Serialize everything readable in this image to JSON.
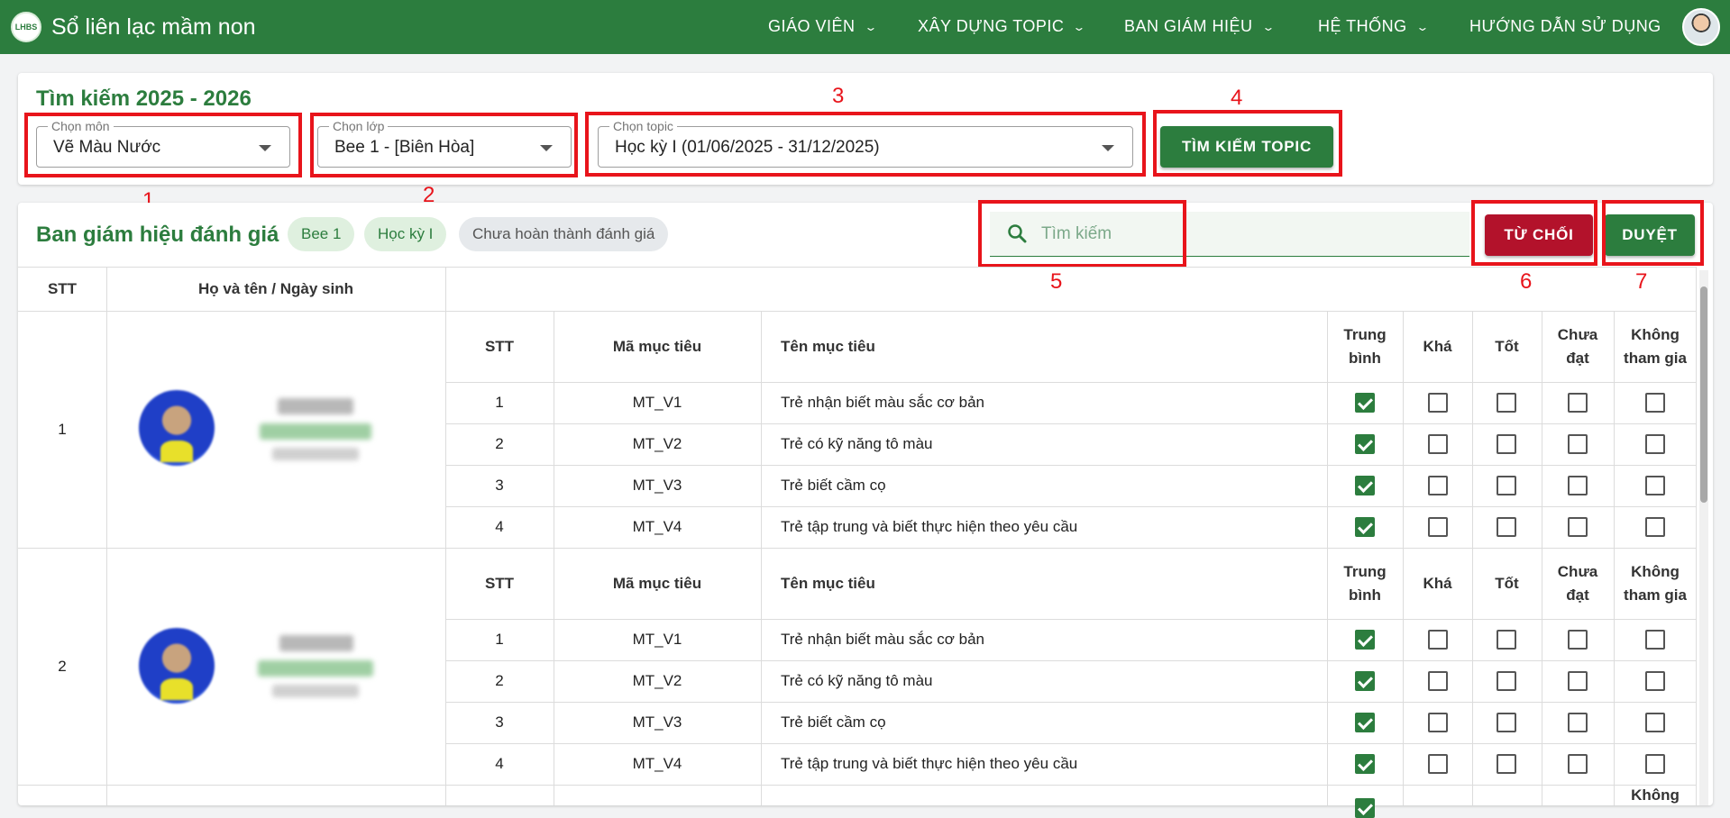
{
  "header": {
    "logo_text": "LHBS",
    "title": "Sổ liên lạc mầm non",
    "nav": [
      "GIÁO VIÊN",
      "XÂY DỰNG TOPIC",
      "BAN GIÁM HIỆU",
      "HỆ THỐNG",
      "HƯỚNG DẪN SỬ DỤNG"
    ],
    "chevron": "⌄"
  },
  "search_card": {
    "title": "Tìm kiếm 2025 - 2026",
    "subject": {
      "label": "Chọn môn",
      "value": "Vẽ Màu Nước"
    },
    "class": {
      "label": "Chọn lớp",
      "value": "Bee 1 - [Biên Hòa]"
    },
    "topic": {
      "label": "Chọn topic",
      "value": "Học kỳ I (01/06/2025 - 31/12/2025)"
    },
    "search_button": "TÌM KIẾM TOPIC"
  },
  "annotations": [
    "1",
    "2",
    "3",
    "4",
    "5",
    "6",
    "7"
  ],
  "eval_card": {
    "title": "Ban giám hiệu đánh giá",
    "chips": [
      "Bee 1",
      "Học kỳ I",
      "Chưa hoàn thành đánh giá"
    ],
    "search_placeholder": "Tìm kiếm",
    "reject_button": "TỪ CHỐI",
    "approve_button": "DUYỆT"
  },
  "table": {
    "outer_headers": {
      "stt": "STT",
      "name": "Họ và tên / Ngày sinh"
    },
    "inner_headers": {
      "stt": "STT",
      "code": "Mã mục tiêu",
      "name": "Tên mục tiêu",
      "levels": [
        "Trung bình",
        "Khá",
        "Tốt",
        "Chưa đạt",
        "Không tham gia"
      ]
    },
    "students": [
      {
        "stt": "1",
        "goals": [
          {
            "stt": "1",
            "code": "MT_V1",
            "name": "Trẻ nhận biết màu sắc cơ bản",
            "checked": 0
          },
          {
            "stt": "2",
            "code": "MT_V2",
            "name": "Trẻ có kỹ năng tô màu",
            "checked": 0
          },
          {
            "stt": "3",
            "code": "MT_V3",
            "name": "Trẻ biết cầm cọ",
            "checked": 0
          },
          {
            "stt": "4",
            "code": "MT_V4",
            "name": "Trẻ tập trung và biết thực hiện theo yêu cầu",
            "checked": 0
          }
        ]
      },
      {
        "stt": "2",
        "goals": [
          {
            "stt": "1",
            "code": "MT_V1",
            "name": "Trẻ nhận biết màu sắc cơ bản",
            "checked": 0
          },
          {
            "stt": "2",
            "code": "MT_V2",
            "name": "Trẻ có kỹ năng tô màu",
            "checked": 0
          },
          {
            "stt": "3",
            "code": "MT_V3",
            "name": "Trẻ biết cầm cọ",
            "checked": 0
          },
          {
            "stt": "4",
            "code": "MT_V4",
            "name": "Trẻ tập trung và biết thực hiện theo yêu cầu",
            "checked": 0
          }
        ]
      }
    ],
    "third_row_partial_header": "Không"
  }
}
